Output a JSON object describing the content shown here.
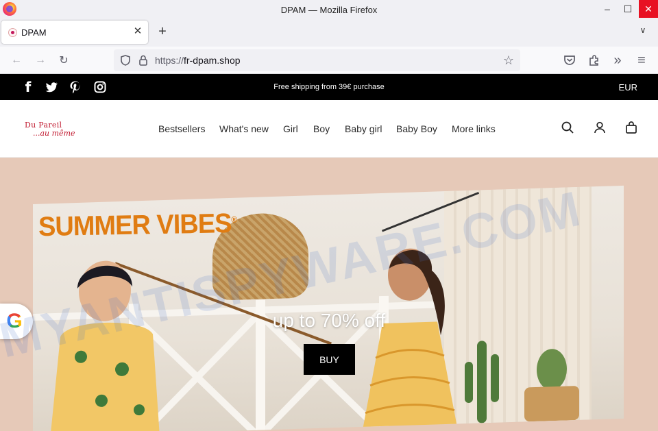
{
  "window": {
    "title": "DPAM — Mozilla Firefox",
    "minimize_glyph": "–",
    "maximize_glyph": "☐",
    "close_glyph": "✕"
  },
  "tabs": [
    {
      "label": "DPAM",
      "close_glyph": "✕"
    }
  ],
  "tabstrip": {
    "new_tab_glyph": "+",
    "list_glyph": "∨"
  },
  "navbar": {
    "back_glyph": "←",
    "forward_glyph": "→",
    "reload_glyph": "↻",
    "url_prefix": "https://",
    "url_domain": "fr-dpam.shop",
    "bookmark_glyph": "☆",
    "overflow_glyph": "»",
    "menu_glyph": "≡"
  },
  "site": {
    "topbar": {
      "shipping_text": "Free shipping from 39€ purchase",
      "currency": "EUR",
      "social": [
        "facebook-icon",
        "twitter-icon",
        "pinterest-icon",
        "instagram-icon"
      ],
      "facebook_glyph": "f"
    },
    "logo": {
      "line1": "Du Pareil",
      "line2": "...au même"
    },
    "menu": [
      "Bestsellers",
      "What's new",
      "Girl",
      "Boy",
      "Baby girl",
      "Baby Boy",
      "More links"
    ],
    "hero": {
      "headline": "SUMMER VIBES",
      "headline_mark": "®",
      "promo": "up to 70% off",
      "button": "BUY",
      "bg_color": "#e6c9b8",
      "headline_color": "#e07c12"
    }
  },
  "overlay": {
    "google_badge": "G",
    "watermark": "MYANTISPYWARE.COM"
  }
}
